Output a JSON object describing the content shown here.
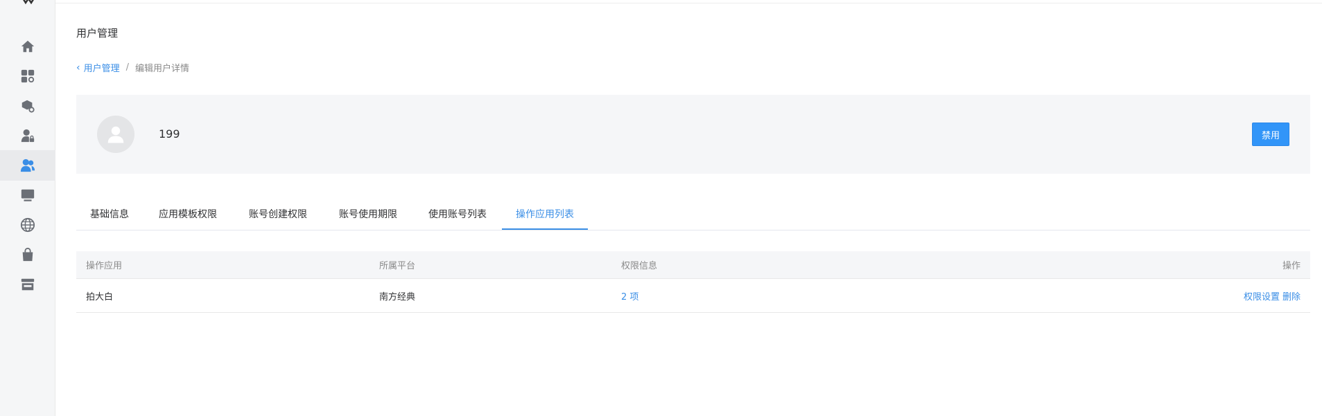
{
  "header": {
    "page_title": "用户管理"
  },
  "breadcrumb": {
    "back_label": "用户管理",
    "separator": "/",
    "current": "编辑用户详情"
  },
  "sidebar": {
    "items": [
      {
        "icon": "home-icon"
      },
      {
        "icon": "apps-settings-icon"
      },
      {
        "icon": "package-settings-icon"
      },
      {
        "icon": "user-lock-icon"
      },
      {
        "icon": "users-icon",
        "active": true
      },
      {
        "icon": "monitor-icon"
      },
      {
        "icon": "globe-icon"
      },
      {
        "icon": "shopping-bag-icon"
      },
      {
        "icon": "store-icon"
      }
    ]
  },
  "user": {
    "name": "199",
    "disable_label": "禁用"
  },
  "tabs": [
    {
      "label": "基础信息"
    },
    {
      "label": "应用模板权限"
    },
    {
      "label": "账号创建权限"
    },
    {
      "label": "账号使用期限"
    },
    {
      "label": "使用账号列表"
    },
    {
      "label": "操作应用列表",
      "active": true
    }
  ],
  "table": {
    "headers": [
      "操作应用",
      "所属平台",
      "权限信息",
      "操作"
    ],
    "rows": [
      {
        "app": "拍大白",
        "platform": "南方经典",
        "permission": "2 项",
        "actions": [
          "权限设置",
          "删除"
        ]
      }
    ]
  },
  "colors": {
    "accent": "#3a8ee6",
    "button": "#3295f8",
    "sidebar_bg": "#f5f6f7",
    "card_bg": "#f5f6f8"
  }
}
